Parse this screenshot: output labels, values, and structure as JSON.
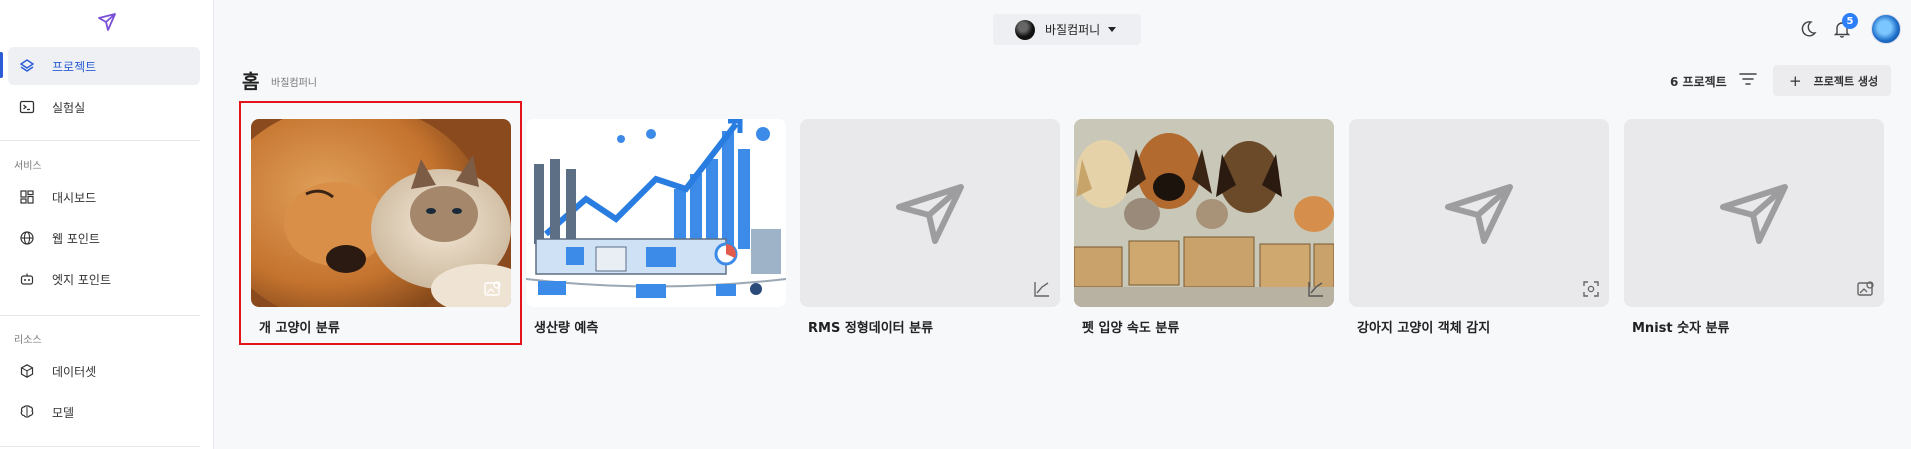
{
  "sidebar": {
    "items": [
      {
        "label": "프로젝트",
        "icon": "layers-icon",
        "active": true
      },
      {
        "label": "실험실",
        "icon": "terminal-icon",
        "active": false
      }
    ],
    "sections": [
      {
        "title": "서비스",
        "items": [
          {
            "label": "대시보드",
            "icon": "dashboard-icon"
          },
          {
            "label": "웹 포인트",
            "icon": "globe-icon"
          },
          {
            "label": "엣지 포인트",
            "icon": "robot-icon"
          }
        ]
      },
      {
        "title": "리소스",
        "items": [
          {
            "label": "데이터셋",
            "icon": "cube-icon"
          },
          {
            "label": "모델",
            "icon": "brain-icon"
          }
        ]
      }
    ]
  },
  "topbar": {
    "workspace": "바질컴퍼니",
    "notification_count": "5"
  },
  "header": {
    "title": "홈",
    "subtitle": "바질컴퍼니",
    "project_count": "6 프로젝트",
    "create_label": "프로젝트 생성"
  },
  "projects": [
    {
      "title": "개 고양이 분류",
      "thumb": "dog-cat-photo",
      "type_icon": "image-classification-icon",
      "selected": true
    },
    {
      "title": "생산량 예측",
      "thumb": "factory-chart-illustration",
      "type_icon": "none"
    },
    {
      "title": "RMS 정형데이터 분류",
      "thumb": "placeholder",
      "type_icon": "line-chart-icon"
    },
    {
      "title": "펫 입양 속도 분류",
      "thumb": "pets-adoption-photo",
      "type_icon": "line-chart-icon"
    },
    {
      "title": "강아지 고양이 객체 감지",
      "thumb": "placeholder",
      "type_icon": "object-detection-icon"
    },
    {
      "title": "Mnist 숫자 분류",
      "thumb": "placeholder",
      "type_icon": "image-classification-icon"
    }
  ],
  "colors": {
    "accent": "#2b5cd6",
    "badge": "#2d7ff9",
    "selection": "#e5141b"
  }
}
